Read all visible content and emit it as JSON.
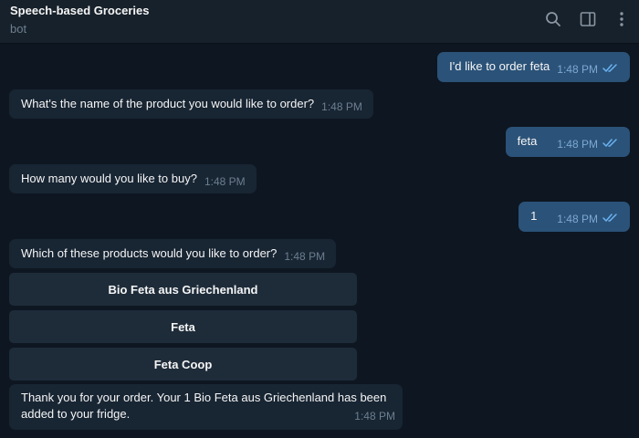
{
  "header": {
    "title": "Speech-based Groceries",
    "subtitle": "bot"
  },
  "icons": [
    "search-icon",
    "sidebar-toggle-icon",
    "more-vertical-icon"
  ],
  "messages": [
    {
      "from": "user",
      "text": "I'd like to order feta",
      "time": "1:48 PM",
      "read": true
    },
    {
      "from": "bot",
      "text": "What's the name of the product you would like to order?",
      "time": "1:48 PM"
    },
    {
      "from": "user",
      "text": "feta",
      "time": "1:48 PM",
      "read": true
    },
    {
      "from": "bot",
      "text": "How many would you like to buy?",
      "time": "1:48 PM"
    },
    {
      "from": "user",
      "text": "1",
      "time": "1:48 PM",
      "read": true
    },
    {
      "from": "bot",
      "text": "Which of these products would you like to order?",
      "time": "1:48 PM"
    },
    {
      "from": "bot",
      "text": "Thank you for your order. Your 1 Bio Feta aus Griechenland has been added to your fridge.",
      "time": "1:48 PM"
    }
  ],
  "keyboard": {
    "buttons": [
      "Bio Feta aus Griechenland",
      "Feta",
      "Feta Coop"
    ]
  },
  "colors": {
    "background": "#0e1621",
    "header": "#17212b",
    "incoming_bubble": "#182533",
    "outgoing_bubble": "#2b5278",
    "keyboard_button": "#1e2c3a",
    "read_check": "#6ab3f3"
  }
}
